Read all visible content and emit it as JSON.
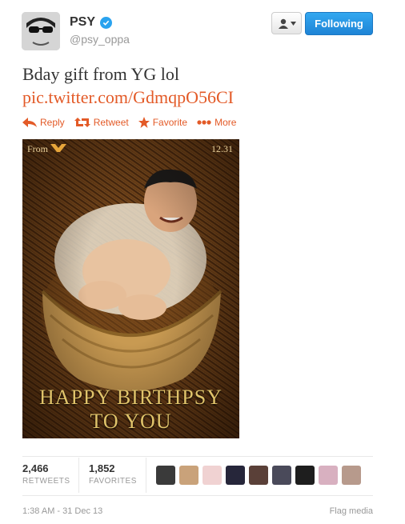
{
  "header": {
    "name": "PSY",
    "handle": "@psy_oppa",
    "follow_label": "Following",
    "verified_icon": "verified-badge-icon",
    "user_menu_icon": "user-dropdown-icon"
  },
  "tweet": {
    "text": "Bday gift from YG lol",
    "link": "pic.twitter.com/GdmqpO56CI"
  },
  "actions": {
    "reply": "Reply",
    "retweet": "Retweet",
    "favorite": "Favorite",
    "more": "More"
  },
  "media": {
    "from": "From",
    "date": "12.31",
    "line1": "HAPPY BIRTHPSY",
    "line2": "TO YOU"
  },
  "stats": {
    "retweets_count": "2,466",
    "retweets_label": "RETWEETS",
    "favorites_count": "1,852",
    "favorites_label": "FAVORITES"
  },
  "footer": {
    "timestamp": "1:38 AM - 31 Dec 13",
    "flag": "Flag media"
  },
  "colors": {
    "accent": "#e35a27",
    "follow_blue": "#2b9bea",
    "muted": "#999999"
  }
}
